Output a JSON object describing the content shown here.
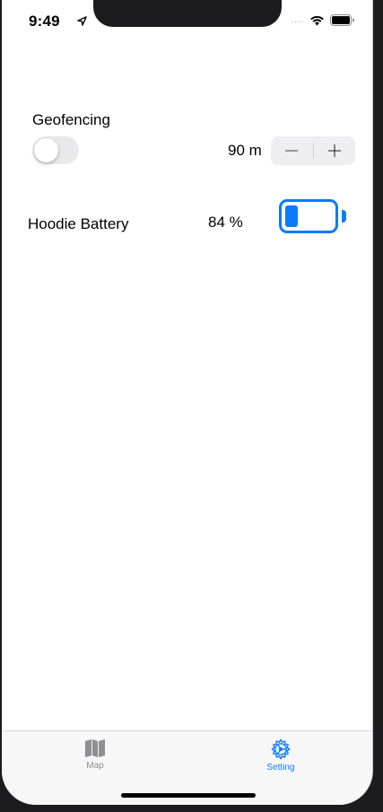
{
  "status_bar": {
    "time": "9:49",
    "signal": "....",
    "icons": [
      "location-arrow-icon",
      "wifi-icon",
      "battery-icon"
    ]
  },
  "geofencing": {
    "label": "Geofencing",
    "enabled": false,
    "distance": "90 m",
    "stepper_minus": "−",
    "stepper_plus": "+"
  },
  "hoodie_battery": {
    "label": "Hoodie Battery",
    "percent_text": "84 %",
    "icon": "battery-icon"
  },
  "tabbar": {
    "tabs": [
      {
        "label": "Map",
        "icon": "map-icon",
        "selected": false
      },
      {
        "label": "Setting",
        "icon": "settings-gear-icon",
        "selected": true
      }
    ]
  },
  "colors": {
    "accent": "#0a7aff",
    "inactive_tab": "#8e8e93",
    "toggle_off": "#e9e9eb"
  }
}
